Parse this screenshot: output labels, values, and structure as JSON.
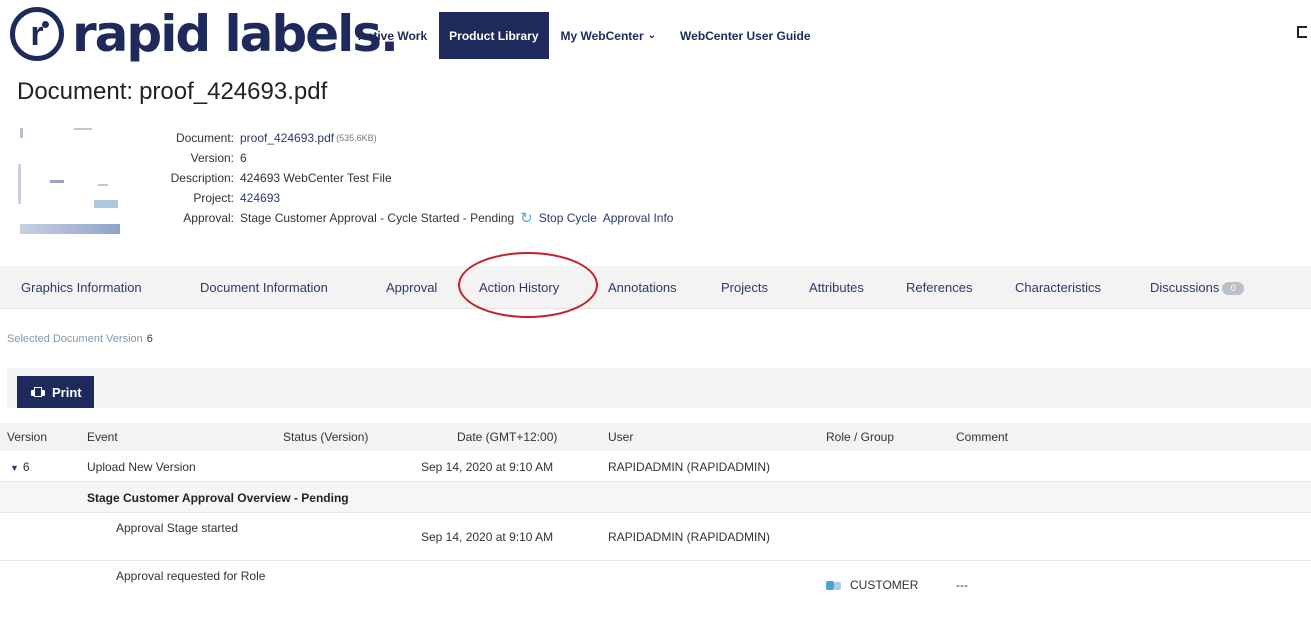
{
  "brand": {
    "logo_mark": "r",
    "logo_text": "rapid labels."
  },
  "nav": {
    "items": [
      {
        "label": "Active Work"
      },
      {
        "label": "Product Library"
      },
      {
        "label": "My WebCenter"
      },
      {
        "label": "WebCenter User Guide"
      }
    ],
    "active_index": 1
  },
  "document": {
    "title_label": "Document:",
    "title_name": "proof_424693.pdf",
    "meta": {
      "document_label": "Document:",
      "document_value": "proof_424693.pdf",
      "document_size": "(535.6KB)",
      "version_label": "Version:",
      "version_value": "6",
      "description_label": "Description:",
      "description_value": "424693 WebCenter Test File",
      "project_label": "Project:",
      "project_value": "424693",
      "approval_label": "Approval:",
      "approval_value": "Stage Customer Approval - Cycle Started - Pending",
      "stop_cycle": "Stop Cycle",
      "approval_info": "Approval Info"
    }
  },
  "tabs": {
    "items": [
      "Graphics Information",
      "Document Information",
      "Approval",
      "Action History",
      "Annotations",
      "Projects",
      "Attributes",
      "References",
      "Characteristics",
      "Discussions"
    ],
    "discussions_count": "0",
    "selected": "Action History"
  },
  "selected_version": {
    "label": "Selected Document Version",
    "value": "6"
  },
  "toolbar": {
    "print_label": "Print"
  },
  "history_table": {
    "headers": {
      "version": "Version",
      "event": "Event",
      "status": "Status (Version)",
      "date": "Date (GMT+12:00)",
      "user": "User",
      "role": "Role / Group",
      "comment": "Comment"
    },
    "rows": [
      {
        "version": "6",
        "event": "Upload New Version",
        "date": "Sep 14, 2020 at 9:10 AM",
        "user": "RAPIDADMIN (RAPIDADMIN)"
      },
      {
        "group": "Stage  Customer Approval  Overview -  Pending"
      },
      {
        "event": "Approval Stage started",
        "date": "Sep 14, 2020 at 9:10 AM",
        "user": "RAPIDADMIN (RAPIDADMIN)"
      },
      {
        "event": "Approval requested for Role",
        "role": "CUSTOMER",
        "comment": "---"
      }
    ]
  },
  "icons": {
    "nav_dropdown": "chevron-down-icon",
    "refresh": "refresh-icon",
    "print": "printer-icon",
    "expand": "triangle-down-icon",
    "role": "role-group-icon"
  },
  "colors": {
    "brand_navy": "#1d2a5b",
    "highlight_red": "#c4202a",
    "link_blue": "#2b3a6b"
  }
}
